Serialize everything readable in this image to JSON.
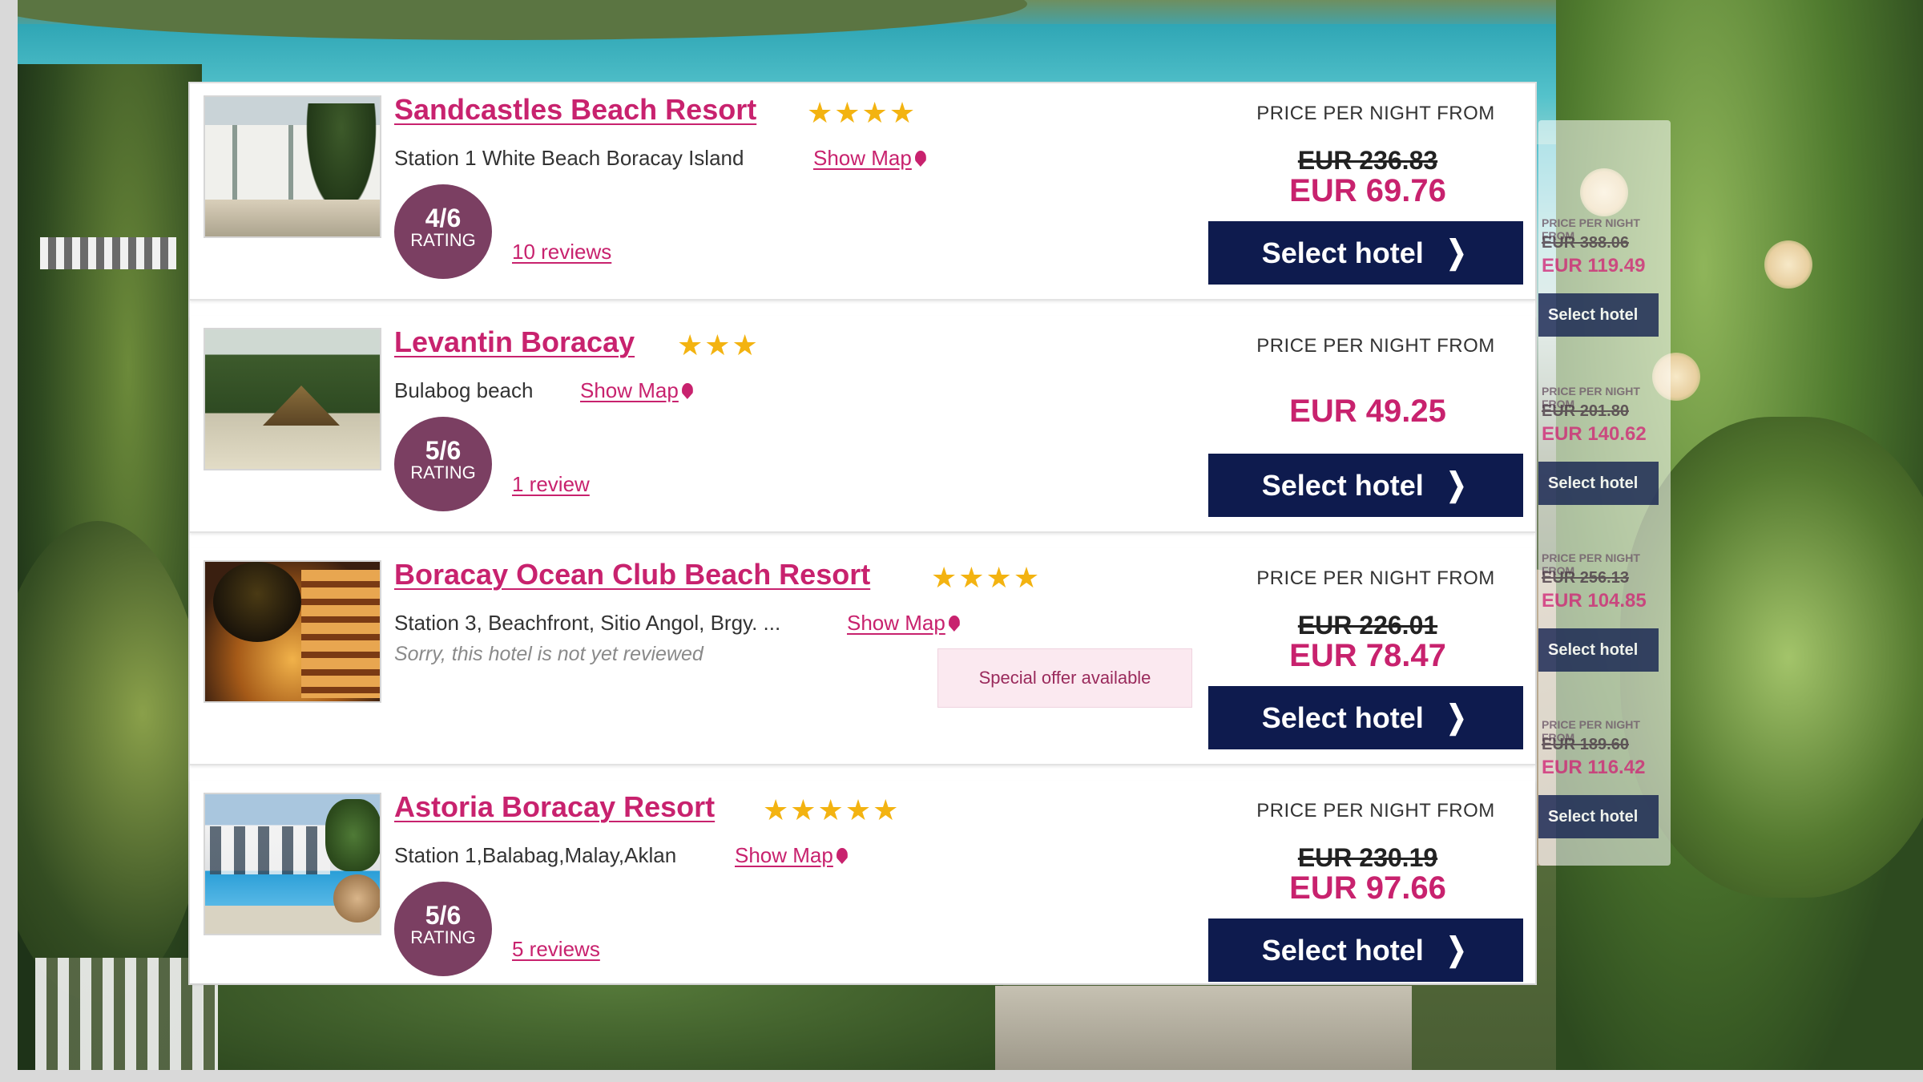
{
  "price_label": "PRICE PER NIGHT FROM",
  "select_label": "Select hotel",
  "chevron": "❯",
  "show_map_label": "Show Map",
  "rating_word": "RATING",
  "hotels": [
    {
      "name": "Sandcastles Beach Resort",
      "stars": "★★★★",
      "address": "Station 1 White Beach Boracay Island",
      "rating": "4/6",
      "reviews": "10 reviews",
      "old_price": "EUR 236.83",
      "price": "EUR 69.76"
    },
    {
      "name": "Levantin Boracay",
      "stars": "★★★",
      "address": "Bulabog beach",
      "rating": "5/6",
      "reviews": "1 review",
      "price": "EUR 49.25"
    },
    {
      "name": "Boracay Ocean Club Beach Resort",
      "stars": "★★★★",
      "address": "Station 3, Beachfront, Sitio Angol, Brgy. ...",
      "not_reviewed": "Sorry, this hotel is not yet reviewed",
      "special_offer": "Special offer available",
      "old_price": "EUR 226.01",
      "price": "EUR 78.47"
    },
    {
      "name": "Astoria Boracay Resort",
      "stars": "★★★★★",
      "address": "Station 1,Balabag,Malay,Aklan",
      "rating": "5/6",
      "reviews": "5 reviews",
      "old_price": "EUR 230.19",
      "price": "EUR 97.66"
    }
  ],
  "ghost_panel": {
    "rows": [
      {
        "label": "PRICE PER NIGHT FROM",
        "old": "EUR 388.06",
        "new": "EUR 119.49",
        "btn": "Select hotel"
      },
      {
        "label": "PRICE PER NIGHT FROM",
        "old": "EUR 201.80",
        "new": "EUR 140.62",
        "btn": "Select hotel"
      },
      {
        "label": "PRICE PER NIGHT FROM",
        "old": "EUR 256.13",
        "new": "EUR 104.85",
        "btn": "Select hotel"
      },
      {
        "label": "PRICE PER NIGHT FROM",
        "old": "EUR 189.60",
        "new": "EUR 116.42",
        "btn": "Select hotel"
      }
    ]
  }
}
